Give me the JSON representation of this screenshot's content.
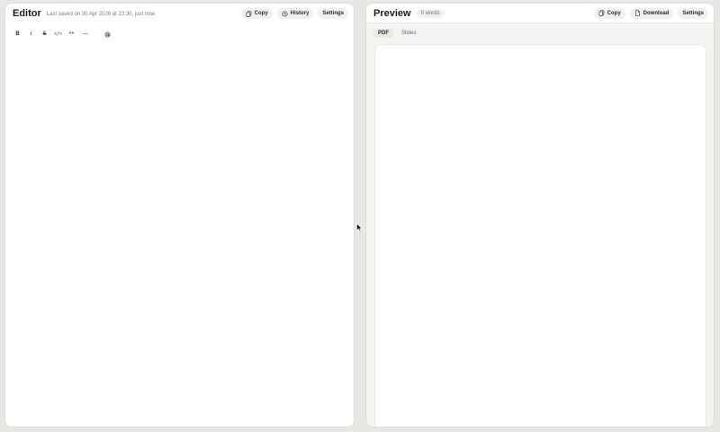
{
  "editor": {
    "title": "Editor",
    "subtitle": "Last saved on 30 Apr 2026 at 23:30, just now",
    "buttons": {
      "copy": "Copy",
      "history": "History",
      "settings": "Settings"
    },
    "toolbar": {
      "bold": "B",
      "italic": "I",
      "strike": "S",
      "code": "</>",
      "quote": "❝❝",
      "rule": "—"
    }
  },
  "preview": {
    "title": "Preview",
    "word_count": "0 words",
    "buttons": {
      "copy": "Copy",
      "download": "Download",
      "settings": "Settings"
    },
    "tabs": [
      "PDF",
      "Slides"
    ],
    "active_tab": "PDF"
  }
}
